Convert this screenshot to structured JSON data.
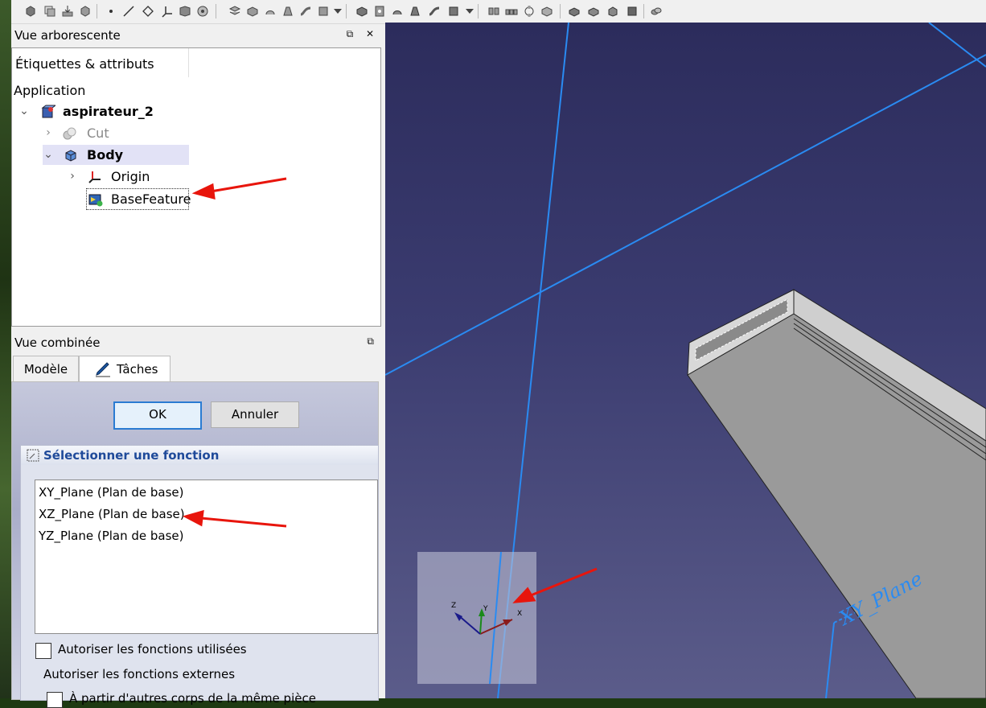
{
  "toolbar": {
    "icons": [
      "part-icon",
      "clone-icon",
      "import-icon",
      "export-icon",
      "point-icon",
      "line-icon",
      "plane-icon",
      "lcs-icon",
      "shape-binder-icon",
      "subshape-binder-icon",
      "sketch-icon",
      "pad-icon",
      "revolve-icon",
      "loft-icon",
      "pipe-icon",
      "helix-icon",
      "pocket-icon",
      "hole-icon",
      "groove-icon",
      "subtractive-loft-icon",
      "subtractive-pipe-icon",
      "mirror-icon",
      "linear-pattern-icon",
      "polar-pattern-icon",
      "fillet-icon",
      "chamfer-icon",
      "draft-icon",
      "thickness-icon",
      "boolean-icon"
    ]
  },
  "tree_panel": {
    "title": "Vue arborescente",
    "dock_buttons": "⧉ ✕",
    "tab_header": "Étiquettes & attributs",
    "root": "Application",
    "items": [
      {
        "label": "aspirateur_2",
        "icon": "document-icon"
      },
      {
        "label": "Cut",
        "icon": "cut-icon"
      },
      {
        "label": "Body",
        "icon": "body-icon"
      },
      {
        "label": "Origin",
        "icon": "origin-icon"
      },
      {
        "label": "BaseFeature",
        "icon": "base-feature-icon"
      }
    ]
  },
  "combo_panel": {
    "title": "Vue combinée",
    "dock_button": "⧉",
    "tabs": [
      {
        "label": "Modèle"
      },
      {
        "label": "Tâches"
      }
    ],
    "ok_label": "OK",
    "cancel_label": "Annuler",
    "select_title": "Sélectionner une fonction",
    "features": [
      "XY_Plane (Plan de base)",
      "XZ_Plane (Plan de base)",
      "YZ_Plane (Plan de base)"
    ],
    "allow_used_label": "Autoriser les fonctions utilisées",
    "allow_external_label": "Autoriser les fonctions externes",
    "partial_row_label": "À partir d'autres corps de la même pièce"
  },
  "view3d": {
    "plane_label": "XY_Plane",
    "axis_labels": {
      "x": "X",
      "y": "Y",
      "z": "Z"
    }
  },
  "colors": {
    "annotation_arrow": "#e8150c",
    "plane_line": "#2a8bf2",
    "link": "#1f4a9a"
  }
}
